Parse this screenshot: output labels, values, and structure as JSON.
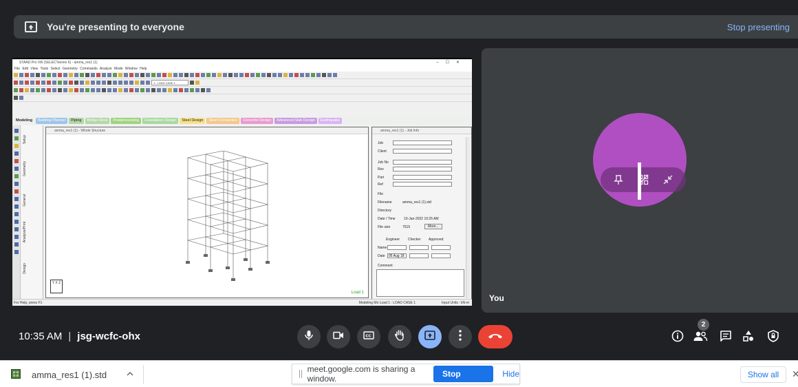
{
  "banner": {
    "message": "You're presenting to everyone",
    "stop_label": "Stop presenting",
    "icon": "present-to-all-icon"
  },
  "shared_screen": {
    "window_title": "STAAD.Pro V8i (SELECTseries 6) - amma_res1 (1)",
    "menu": "File  Edit  View  Tools  Select  Geometry  Commands  Analyze  Mode  Window  Help",
    "load_case_combo": "1 : LOAD CASE 1",
    "tabs": [
      "Modeling",
      "Building Planner",
      "Piping",
      "Bridge Deck",
      "Postprocessing",
      "Foundation Design",
      "Steel Design",
      "Steel Connection",
      "Concrete Design",
      "Advanced Slab Design",
      "Earthquake"
    ],
    "side_tabs": [
      "Setup",
      "Geometry",
      "General",
      "Analysis/Print",
      "Design"
    ],
    "view_title": "amma_res1 (1) - Whole Structure",
    "load_label": "Load 1",
    "axis_label": "Y X Z",
    "job_title": "amma_res1 (1) - Job Info",
    "job_fields": [
      "Job",
      "Client",
      "Job No",
      "Rev",
      "Part",
      "Ref"
    ],
    "file_section": "File",
    "filename_label": "Filename",
    "filename_value": "amma_res1 (1).std",
    "directory_label": "Directory",
    "datetime_label": "Date / Time",
    "datetime_value": "10-Jan-2022   10:25 AM",
    "filesize_label": "File size",
    "filesize_value": "7515",
    "more_label": "More...",
    "engineer_label": "Engineer",
    "checker_label": "Checker",
    "approved_label": "Approved",
    "name_label": "Name",
    "date_label": "Date",
    "date_value": "05 Aug 18",
    "comment_label": "Comment",
    "status_left": "For Help, press F1",
    "status_mode": "Modeling Mo  Load 1 : LOAD CASE 1",
    "status_units": "Input Units : kN-m"
  },
  "self_tile": {
    "label": "You",
    "avatar_color": "#b04fc1",
    "pin_icon": "pin-icon",
    "hide_icon": "hide-self-view-icon",
    "minimize_icon": "minimize-icon"
  },
  "bottom_bar": {
    "time": "10:35 AM",
    "separator": "|",
    "meeting_code": "jsg-wcfc-ohx",
    "participant_count": "2",
    "controls": [
      "microphone-icon",
      "camera-icon",
      "captions-icon",
      "raise-hand-icon",
      "present-icon",
      "more-options-icon",
      "end-call-icon"
    ],
    "right_icons": [
      "info-icon",
      "people-icon",
      "chat-icon",
      "activities-icon",
      "host-controls-icon"
    ]
  },
  "download_bar": {
    "file_name": "amma_res1 (1).std",
    "share_message": "meet.google.com is sharing a window.",
    "stop_sharing_label": "Stop sharing",
    "hide_label": "Hide",
    "show_all_label": "Show all",
    "close_label": "✕"
  },
  "colors": {
    "background": "#202124",
    "surface": "#3c4043",
    "accent_blue": "#8ab4f8",
    "end_call_red": "#ea4335",
    "chrome_blue": "#1a73e8"
  }
}
